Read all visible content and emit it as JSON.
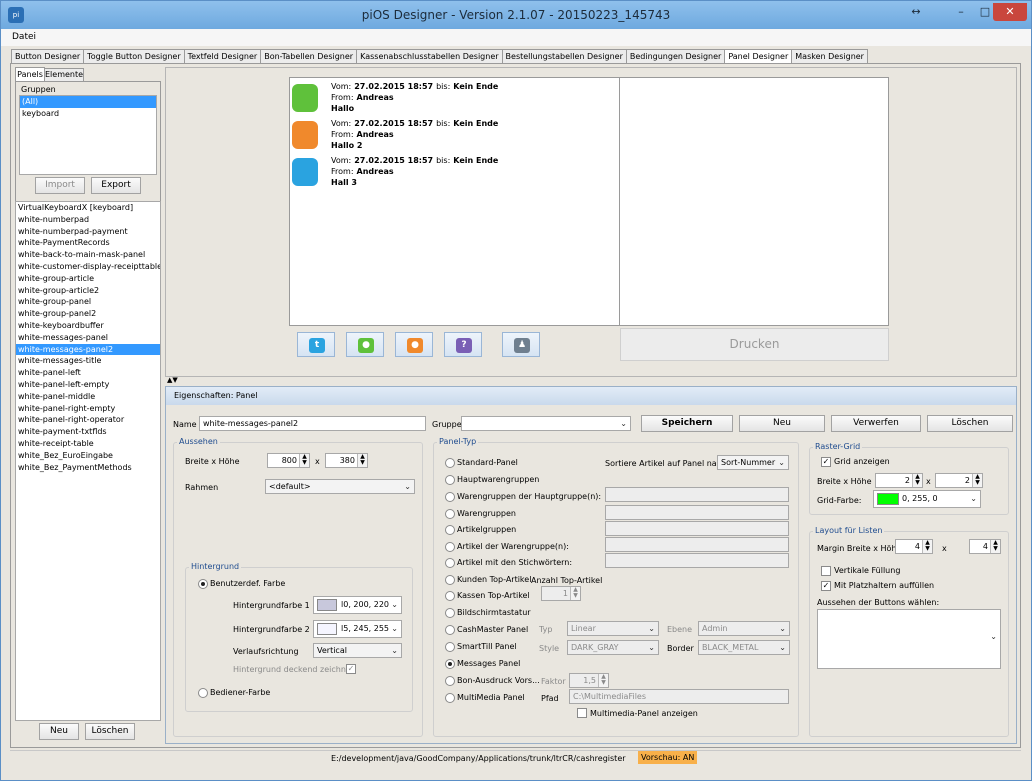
{
  "window": {
    "title": "piOS Designer - Version 2.1.07 - 20150223_145743",
    "app_icon": "pios-icon",
    "resize_glyph": "↔",
    "minimize_glyph": "–",
    "maximize_glyph": "□",
    "close_glyph": "✕"
  },
  "menu": {
    "file": "Datei"
  },
  "tabs": [
    "Button Designer",
    "Toggle Button Designer",
    "Textfeld Designer",
    "Bon-Tabellen Designer",
    "Kassenabschlusstabellen Designer",
    "Bestellungstabellen Designer",
    "Bedingungen Designer",
    "Panel Designer",
    "Masken Designer"
  ],
  "active_tab": "Panel Designer",
  "left": {
    "tab_panels": "Panels",
    "tab_elements": "Elemente",
    "groups_label": "Gruppen",
    "groups": [
      "(All)",
      "keyboard"
    ],
    "import": "Import",
    "export": "Export",
    "panels": [
      "VirtualKeyboardX [keyboard]",
      "white-numberpad",
      "white-numberpad-payment",
      "white-PaymentRecords",
      "white-back-to-main-mask-panel",
      "white-customer-display-receipttable",
      "white-group-article",
      "white-group-article2",
      "white-group-panel",
      "white-group-panel2",
      "white-keyboardbuffer",
      "white-messages-panel",
      "white-messages-panel2",
      "white-messages-title",
      "white-panel-left",
      "white-panel-left-empty",
      "white-panel-middle",
      "white-panel-right-empty",
      "white-panel-right-operator",
      "white-payment-txtflds",
      "white-receipt-table",
      "white_Bez_EuroEingabe",
      "white_Bez_PaymentMethods"
    ],
    "selected_panel": "white-messages-panel2",
    "new": "Neu",
    "delete": "Löschen"
  },
  "preview": {
    "messages": [
      {
        "icon": "message-green-icon",
        "color": "#5fc13b",
        "vom_label": "Vom:",
        "vom": "27.02.2015 18:57",
        "bis_label": "bis:",
        "bis": "Kein Ende",
        "from_label": "From:",
        "from": "Andreas",
        "text": "Hallo"
      },
      {
        "icon": "message-orange-icon",
        "color": "#f0892c",
        "vom_label": "Vom:",
        "vom": "27.02.2015 18:57",
        "bis_label": "bis:",
        "bis": "Kein Ende",
        "from_label": "From:",
        "from": "Andreas",
        "text": "Hallo 2"
      },
      {
        "icon": "twitter-icon",
        "color": "#2aa3e0",
        "vom_label": "Vom:",
        "vom": "27.02.2015 18:57",
        "bis_label": "bis:",
        "bis": "Kein Ende",
        "from_label": "From:",
        "from": "Andreas",
        "text": "Hall 3"
      }
    ],
    "print": "Drucken",
    "toggle_glyph": "▲▼"
  },
  "props": {
    "title": "Eigenschaften: Panel",
    "name_label": "Name",
    "name_value": "white-messages-panel2",
    "group_label": "Gruppe",
    "group_value": "",
    "save": "Speichern",
    "new": "Neu",
    "discard": "Verwerfen",
    "delete": "Löschen",
    "look": {
      "title": "Aussehen",
      "size_label": "Breite x Höhe",
      "width": "800",
      "x": "x",
      "height": "380",
      "border_label": "Rahmen",
      "border_value": "<default>",
      "bg_title": "Hintergrund",
      "custom_color": "Benutzerdef. Farbe",
      "bg1_label": "Hintergrundfarbe 1",
      "bg1_value": "l0, 200, 220",
      "bg1_color": "#c8c8dc",
      "bg2_label": "Hintergrundfarbe 2",
      "bg2_value": "l5, 245, 255",
      "bg2_color": "#f5f5ff",
      "direction_label": "Verlaufsrichtung",
      "direction_value": "Vertical",
      "opaque_label": "Hintergrund deckend zeichnen",
      "operator_color": "Bediener-Farbe"
    },
    "type": {
      "title": "Panel-Typ",
      "options": [
        "Standard-Panel",
        "Hauptwarengruppen",
        "Warengruppen der Hauptgruppe(n):",
        "Warengruppen",
        "Artikelgruppen",
        "Artikel der Warengruppe(n):",
        "Artikel mit den Stichwörtern:",
        "Kunden Top-Artikel",
        "Kassen Top-Artikel",
        "Bildschirmtastatur",
        "CashMaster Panel",
        "SmartTill Panel",
        "Messages Panel",
        "Bon-Ausdruck Vors...",
        "MultiMedia Panel"
      ],
      "selected": "Messages Panel",
      "sort_label": "Sortiere Artikel auf Panel nach",
      "sort_value": "Sort-Nummer",
      "count_label": "Anzahl Top-Artikel",
      "count_value": "1",
      "typ_label": "Typ",
      "typ_value": "Linear",
      "ebene_label": "Ebene",
      "ebene_value": "Admin",
      "style_label": "Style",
      "style_value": "DARK_GRAY",
      "border_label": "Border",
      "border_value": "BLACK_METAL",
      "faktor_label": "Faktor",
      "faktor_value": "1,5",
      "pfad_label": "Pfad",
      "pfad_value": "C:\\MultimediaFiles",
      "mm_show": "Multimedia-Panel anzeigen"
    },
    "grid": {
      "title": "Raster-Grid",
      "show": "Grid anzeigen",
      "size_label": "Breite x Höhe",
      "w": "2",
      "x": "x",
      "h": "2",
      "color_label": "Grid-Farbe:",
      "color_value": "0, 255, 0",
      "color_swatch": "#00ff00"
    },
    "layout": {
      "title": "Layout für Listen",
      "margin_label": "Margin Breite x Höhe",
      "mw": "4",
      "x": "x",
      "mh": "4",
      "vfill": "Vertikale Füllung",
      "placeholder": "Mit Platzhaltern auffüllen",
      "buttons_label": "Aussehen der Buttons wählen:"
    }
  },
  "status": {
    "path": "E:/development/java/GoodCompany/Applications/trunk/ltrCR/cashregister",
    "preview": "Vorschau: AN"
  }
}
